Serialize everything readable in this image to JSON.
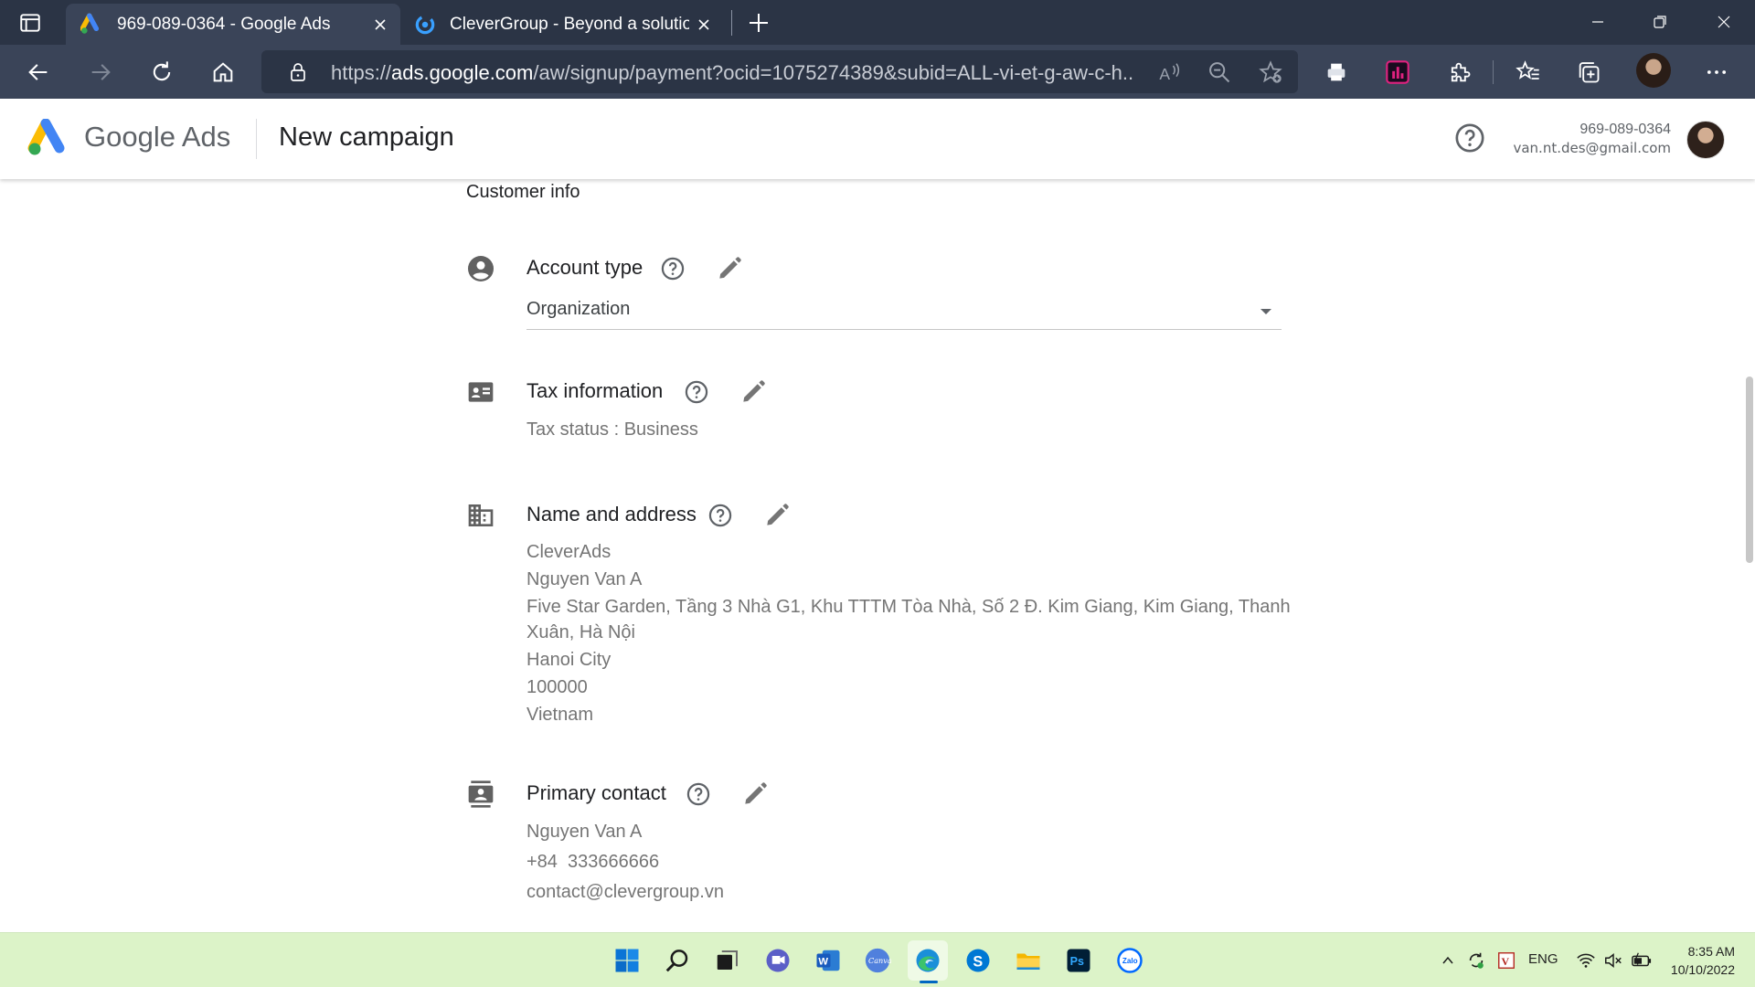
{
  "browser": {
    "tabs": [
      {
        "title": "969-089-0364 - Google Ads",
        "active": true
      },
      {
        "title": "CleverGroup - Beyond a solution",
        "active": false
      }
    ],
    "url": {
      "scheme": "https://",
      "host": "ads.google.com",
      "path": "/aw/signup/payment?ocid=1075274389&subid=ALL-vi-et-g-aw-c-h..."
    }
  },
  "header": {
    "brand": "Google Ads",
    "page_title": "New campaign",
    "account_id": "969-089-0364",
    "account_email": "van.nt.des@gmail.com"
  },
  "customer_info": {
    "heading": "Customer info",
    "account_type": {
      "title": "Account type",
      "value": "Organization"
    },
    "tax_information": {
      "title": "Tax information",
      "status_label": "Tax status",
      "status_value": "Business"
    },
    "name_and_address": {
      "title": "Name and address",
      "lines": [
        "CleverAds",
        "Nguyen Van A",
        "Five Star Garden, Tầng 3 Nhà G1, Khu TTTM Tòa Nhà, Số 2 Đ. Kim Giang, Kim Giang, Thanh",
        "Xuân, Hà Nội",
        "Hanoi City",
        "100000",
        "Vietnam"
      ]
    },
    "primary_contact": {
      "title": "Primary contact",
      "name": "Nguyen Van A",
      "phone": "+84  333666666",
      "email": "contact@clevergroup.vn"
    }
  },
  "taskbar": {
    "language": "ENG",
    "time": "8:35 AM",
    "date": "10/10/2022"
  }
}
